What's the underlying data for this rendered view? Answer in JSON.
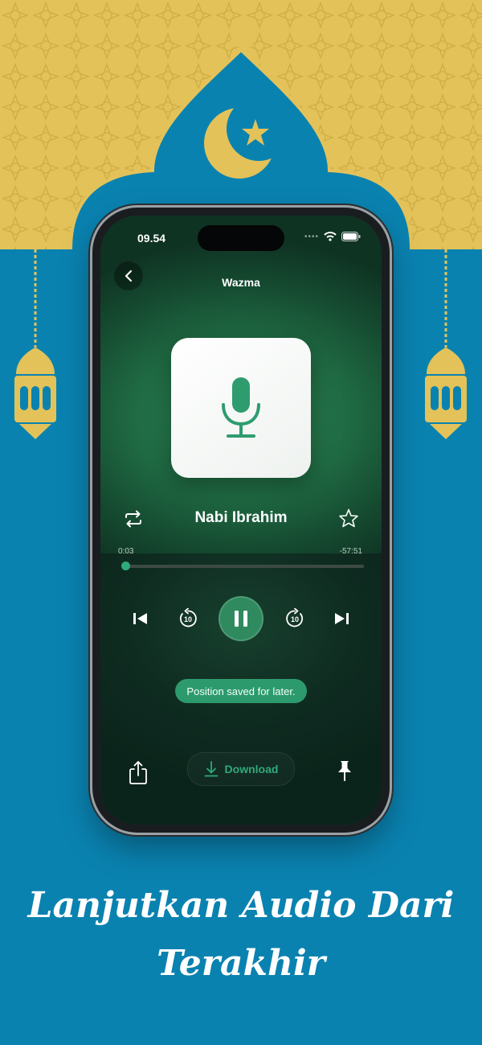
{
  "status_bar": {
    "time": "09.54"
  },
  "header": {
    "title": "Wazma"
  },
  "player": {
    "track_title": "Nabi Ibrahim",
    "elapsed": "0:03",
    "remaining": "-57:51",
    "progress_fraction": 0.01,
    "skip_back_seconds": "10",
    "skip_forward_seconds": "10"
  },
  "toast": {
    "message": "Position saved for later."
  },
  "bottom_bar": {
    "download_label": "Download"
  },
  "promo": {
    "headline_line1": "Lanjutkan Audio Dari",
    "headline_line2": "Terakhir"
  },
  "colors": {
    "background": "#0a82b0",
    "gold": "#e3c25a",
    "accent_green": "#2faa7a",
    "toast": "#2d9a6d"
  },
  "icons": [
    "crescent-star-icon",
    "lantern-icon",
    "back-chevron-icon",
    "wifi-icon",
    "battery-icon",
    "microphone-icon",
    "repeat-icon",
    "star-icon",
    "skip-previous-icon",
    "rewind-10-icon",
    "pause-icon",
    "forward-10-icon",
    "skip-next-icon",
    "share-icon",
    "download-icon",
    "pin-icon"
  ]
}
